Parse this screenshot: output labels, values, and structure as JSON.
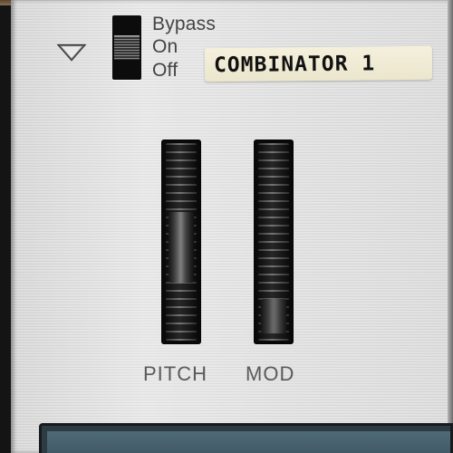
{
  "device": {
    "mode_switch": {
      "labels": {
        "bypass": "Bypass",
        "on": "On",
        "off": "Off"
      },
      "selected": "On"
    },
    "name": "COMBINATOR 1"
  },
  "wheels": [
    {
      "label": "PITCH"
    },
    {
      "label": "MOD"
    }
  ],
  "icons": {
    "fold": "triangle-down-icon"
  },
  "colors": {
    "panel": "#e0e0e0",
    "label_text": "#5a5a5a",
    "tape": "#f1ecd5",
    "display": "#4a6472"
  }
}
